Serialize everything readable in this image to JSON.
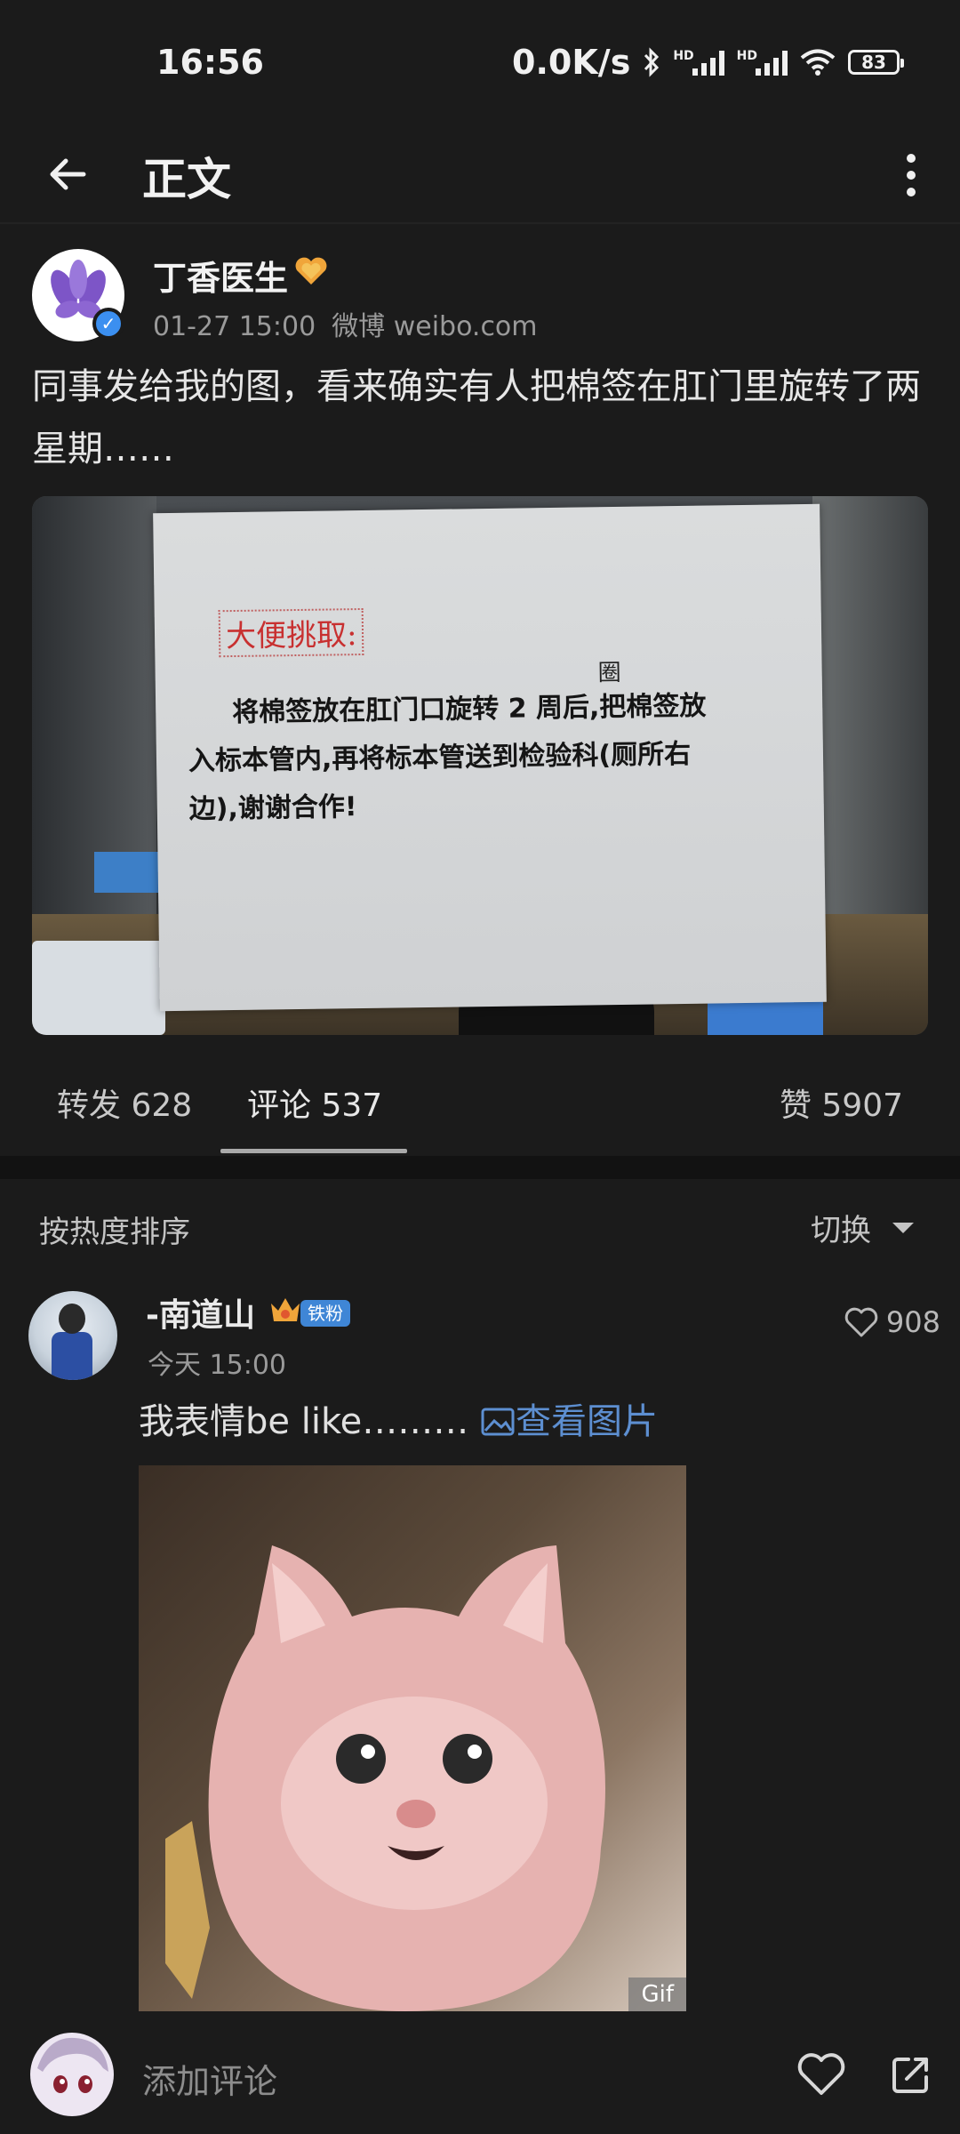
{
  "status_bar": {
    "time": "16:56",
    "net_speed": "0.0K/s",
    "battery": "83"
  },
  "top_bar": {
    "title": "正文"
  },
  "post": {
    "author": "丁香医生",
    "date": "01-27 15:00",
    "source": "微博 weibo.com",
    "text": "同事发给我的图，看来确实有人把棉签在肛门里旋转了两星期……",
    "image_text": {
      "heading": "大便挑取:",
      "line1": "将棉签放在肛门口旋转 2 周后,把棉签放",
      "line2": "入标本管内,再将标本管送到检验科(厕所右",
      "line3": "边),谢谢合作!",
      "handwritten": "圈"
    }
  },
  "stats": {
    "repost": "转发 628",
    "comment": "评论 537",
    "like": "赞 5907"
  },
  "sort": {
    "label": "按热度排序",
    "switch": "切换"
  },
  "comment": {
    "name": "-南道山",
    "fan_badge": "铁粉",
    "time": "今天 15:00",
    "likes": "908",
    "text": "我表情be like………",
    "link": "查看图片",
    "gif_badge": "Gif"
  },
  "bottom": {
    "placeholder": "添加评论"
  },
  "colors": {
    "background": "#1b1b1b",
    "link": "#5d8fd1",
    "verified": "#3b8ff0",
    "fan_badge": "#3f86d6"
  }
}
